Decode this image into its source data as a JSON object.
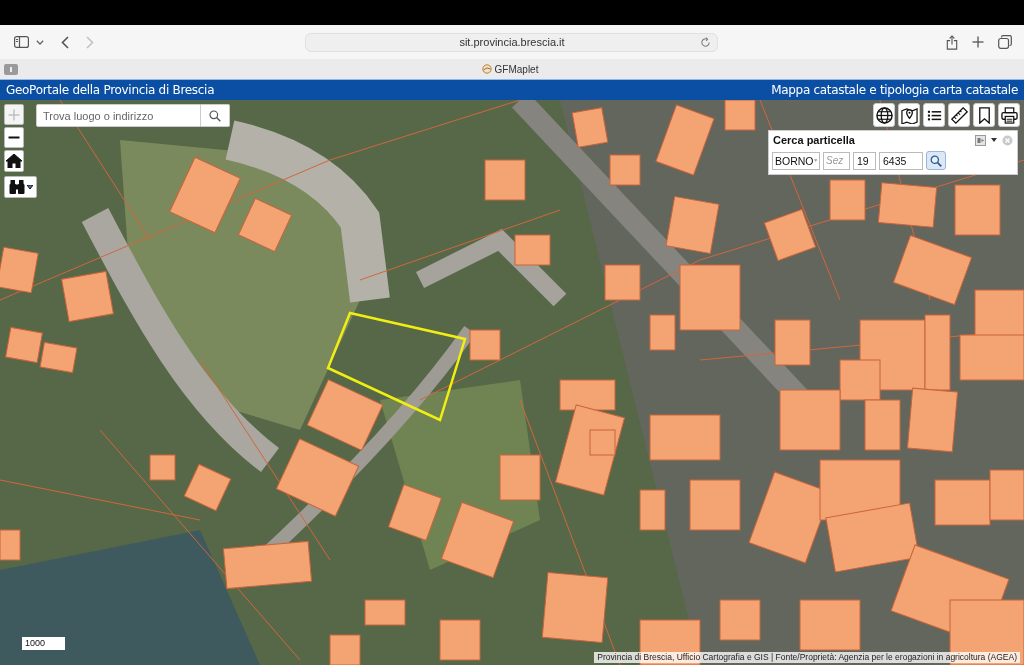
{
  "browser": {
    "url": "sit.provincia.brescia.it",
    "back": {
      "disabled": false
    },
    "forward": {
      "disabled": true
    },
    "tab": {
      "title": "GFMaplet"
    }
  },
  "header": {
    "title": "GeoPortale della Provincia di Brescia",
    "map_title": "Mappa catastale e tipologia carta catastale"
  },
  "search": {
    "placeholder": "Trova luogo o indirizzo"
  },
  "zoom_in": {
    "disabled": true
  },
  "zoom_out": {
    "disabled": false
  },
  "parcel_search": {
    "title": "Cerca particella",
    "municipality": "BORNO",
    "section": {
      "placeholder": "Sez"
    },
    "sheet": "19",
    "parcel": "6435"
  },
  "scale": {
    "label": "1000"
  },
  "attribution": "Provincia di Brescia, Ufficio Cartografia e GIS | Fonte/Proprietà: Agenzia per le erogazioni in agricoltura (AGEA)"
}
